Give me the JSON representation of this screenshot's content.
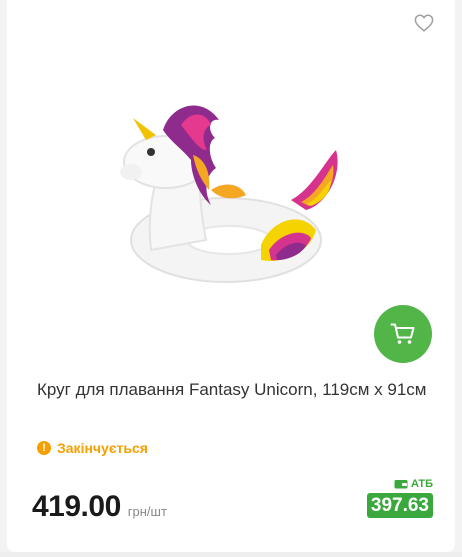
{
  "product": {
    "title": "Круг для плавання Fantasy Unicorn, 119см х 91см",
    "status": "Закінчується",
    "status_icon": "!",
    "price": "419.00",
    "unit": "грн/шт",
    "promo_brand": "АТБ",
    "promo_price": "397.63",
    "image_name": "unicorn-swim-ring"
  },
  "colors": {
    "accent_green": "#52b548",
    "promo_green": "#3aa83d",
    "warning_orange": "#f5a000"
  }
}
